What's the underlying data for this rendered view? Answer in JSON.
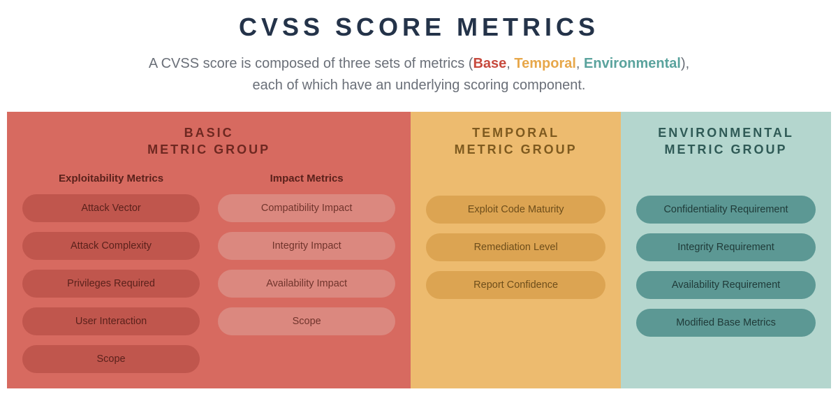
{
  "title": "CVSS SCORE METRICS",
  "subtitle": {
    "pre": "A CVSS score is composed of three sets of metrics (",
    "base": "Base",
    "sep1": ", ",
    "temporal": "Temporal",
    "sep2": ", ",
    "environmental": "Environmental",
    "post1": "),",
    "post2": "each of which have an underlying scoring component."
  },
  "panels": {
    "basic": {
      "heading1": "BASIC",
      "heading2": "METRIC GROUP",
      "col_a_title": "Exploitability Metrics",
      "col_a": [
        "Attack Vector",
        "Attack Complexity",
        "Privileges Required",
        "User Interaction",
        "Scope"
      ],
      "col_b_title": "Impact Metrics",
      "col_b": [
        "Compatibility Impact",
        "Integrity Impact",
        "Availability Impact",
        "Scope"
      ]
    },
    "temporal": {
      "heading1": "TEMPORAL",
      "heading2": "METRIC GROUP",
      "items": [
        "Exploit Code Maturity",
        "Remediation Level",
        "Report Confidence"
      ]
    },
    "environmental": {
      "heading1": "ENVIRONMENTAL",
      "heading2": "METRIC GROUP",
      "items": [
        "Confidentiality Requirement",
        "Integrity Requirement",
        "Availability Requirement",
        "Modified Base Metrics"
      ]
    }
  },
  "colors": {
    "base": "#c74a3e",
    "temporal": "#e7a74a",
    "environmental": "#5aa39d"
  }
}
